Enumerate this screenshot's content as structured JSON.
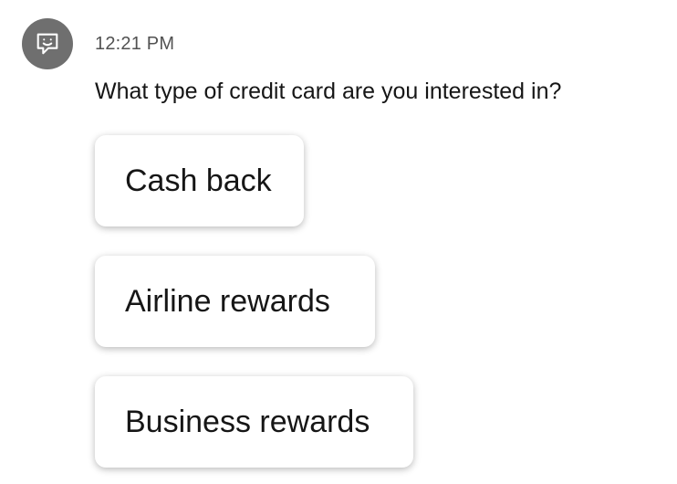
{
  "chat": {
    "avatar_icon": "chatbot-face-icon",
    "avatar_color": "#6f6f6f",
    "timestamp": "12:21 PM",
    "message": "What type of credit card are you interested in?",
    "options": [
      {
        "label": "Cash back"
      },
      {
        "label": "Airline rewards"
      },
      {
        "label": "Business rewards"
      }
    ]
  }
}
